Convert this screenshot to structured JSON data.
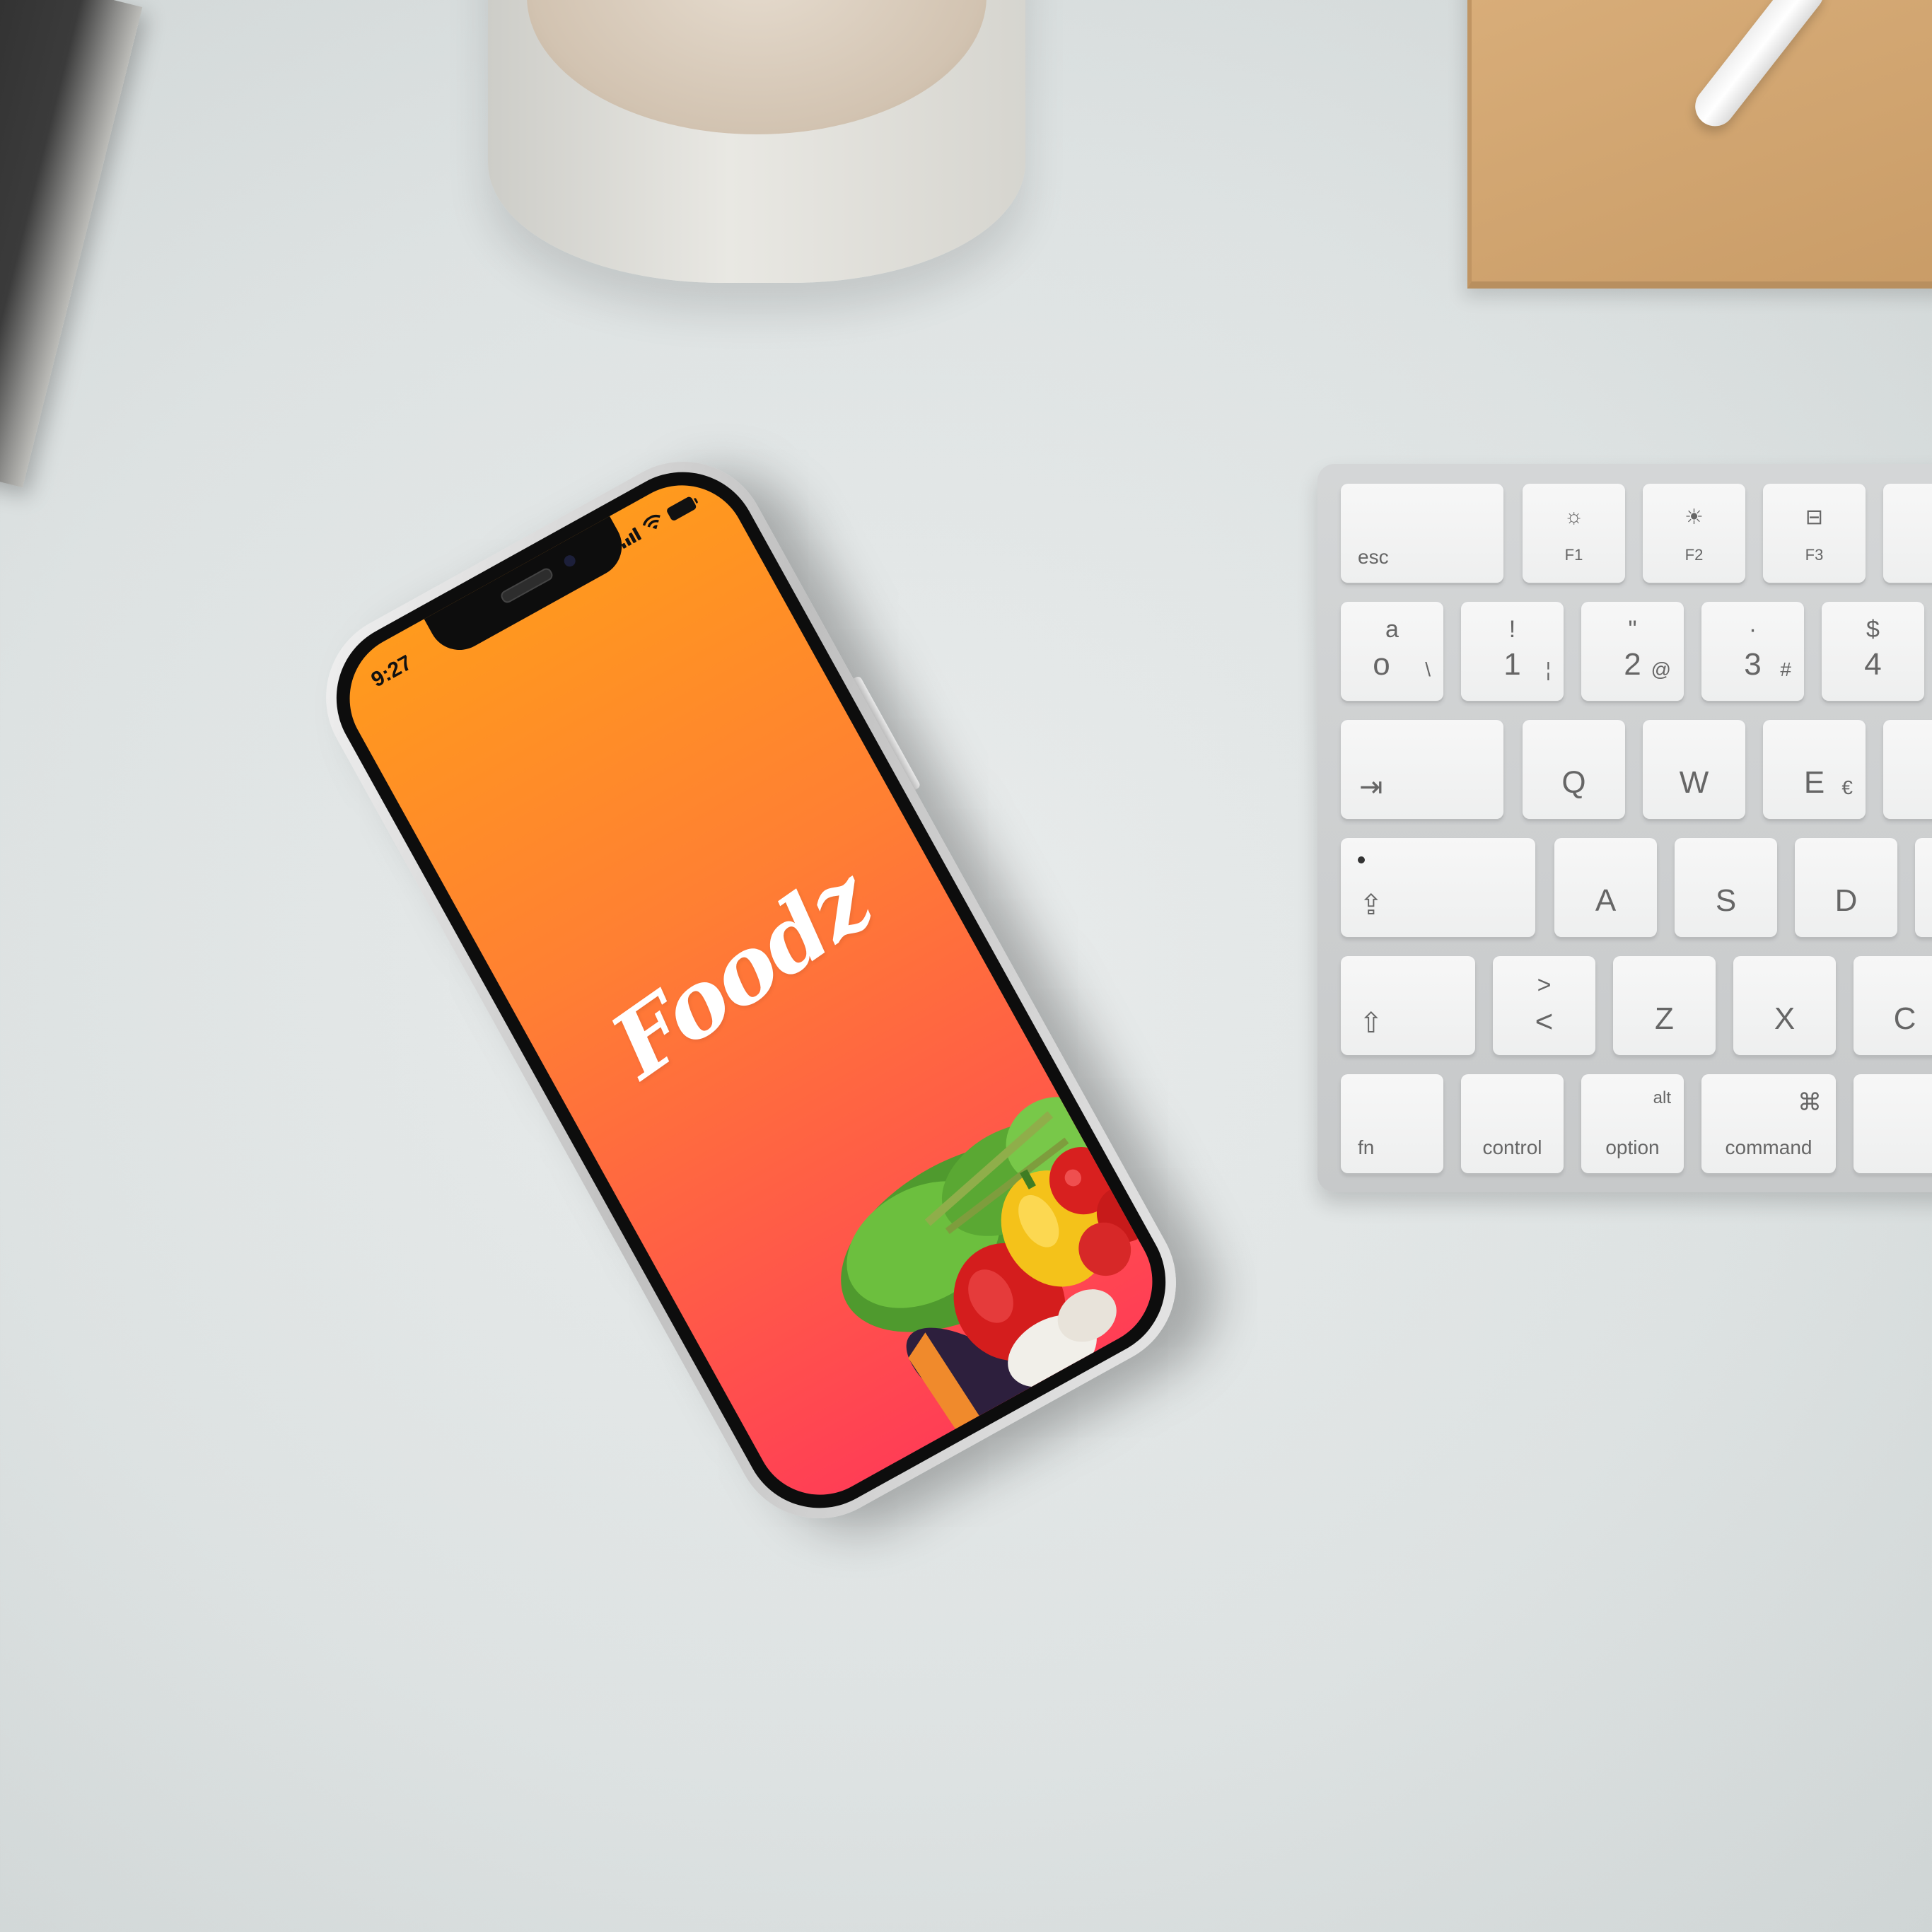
{
  "phone": {
    "status_time": "9:27",
    "app_name": "Foodz",
    "colors": {
      "gradient_top": "#ff9a1d",
      "gradient_bottom": "#ff3e55"
    }
  },
  "keyboard": {
    "row_fn": {
      "esc": "esc",
      "f1": "F1",
      "f2": "F2",
      "f3": "F3"
    },
    "row_num": [
      {
        "top": "a",
        "main": "o",
        "sub": "\\"
      },
      {
        "top": "!",
        "main": "1",
        "sub": "¦"
      },
      {
        "top": "\"",
        "main": "2",
        "sub": "@"
      },
      {
        "top": "·",
        "main": "3",
        "sub": "#"
      },
      {
        "top": "$",
        "main": "4",
        "sub": ""
      }
    ],
    "row_q": {
      "tab": "⇥",
      "keys": [
        "Q",
        "W",
        "E"
      ],
      "e_sub": "€"
    },
    "row_a": {
      "keys": [
        "A",
        "S",
        "D"
      ]
    },
    "row_z": {
      "angle_top": ">",
      "angle_bottom": "<",
      "keys": [
        "Z",
        "X",
        "C"
      ]
    },
    "row_mod": {
      "fn": "fn",
      "control": "control",
      "alt": "alt",
      "option": "option",
      "cmd_symbol": "⌘",
      "command": "command"
    }
  }
}
